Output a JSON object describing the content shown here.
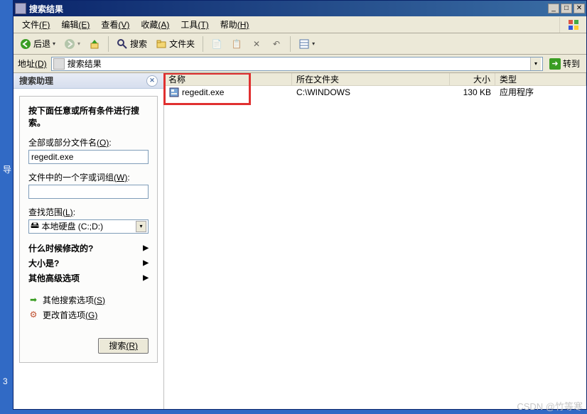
{
  "desktop": {
    "label_top": "导",
    "label_bottom": "3"
  },
  "window": {
    "title": "搜索结果",
    "buttons": {
      "min": "_",
      "max": "□",
      "close": "✕"
    }
  },
  "menubar": {
    "file": {
      "label": "文件",
      "accel": "(F)"
    },
    "edit": {
      "label": "编辑",
      "accel": "(E)"
    },
    "view": {
      "label": "查看",
      "accel": "(V)"
    },
    "favorites": {
      "label": "收藏",
      "accel": "(A)"
    },
    "tools": {
      "label": "工具",
      "accel": "(T)"
    },
    "help": {
      "label": "帮助",
      "accel": "(H)"
    }
  },
  "toolbar": {
    "back": "后退",
    "search": "搜索",
    "folders": "文件夹"
  },
  "address": {
    "label": "地址",
    "accel": "(D)",
    "value": "搜索结果",
    "go": "转到"
  },
  "sidebar": {
    "header": "搜索助理",
    "panel_title": "按下面任意或所有条件进行搜索。",
    "filename_label_pre": "全部或部分文件名",
    "filename_label_accel": "(O)",
    "filename_value": "regedit.exe",
    "word_label_pre": "文件中的一个字或词组",
    "word_label_accel": "(W)",
    "word_value": "",
    "lookin_label_pre": "查找范围",
    "lookin_label_accel": "(L)",
    "lookin_value": "本地硬盘 (C:;D:)",
    "when_modified": "什么时候修改的?",
    "size": "大小是?",
    "more_adv": "其他高级选项",
    "other_search_pre": "其他搜索选项",
    "other_search_accel": "(S)",
    "change_pref_pre": "更改首选项",
    "change_pref_accel": "(G)",
    "search_btn_pre": "搜索",
    "search_btn_accel": "(R)"
  },
  "list": {
    "columns": {
      "name": "名称",
      "folder": "所在文件夹",
      "size": "大小",
      "type": "类型"
    },
    "rows": [
      {
        "name": "regedit.exe",
        "folder": "C:\\WINDOWS",
        "size": "130 KB",
        "type": "应用程序"
      }
    ]
  },
  "watermark": "CSDN @竹等寒"
}
